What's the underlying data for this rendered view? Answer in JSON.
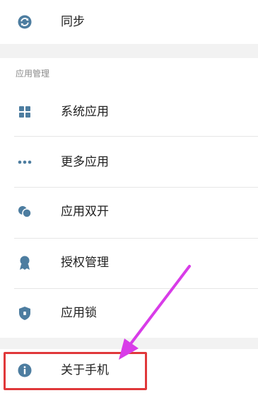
{
  "sync_item": {
    "label": "同步",
    "icon": "sync-icon"
  },
  "app_management": {
    "title": "应用管理",
    "items": [
      {
        "label": "系统应用",
        "icon": "grid-icon"
      },
      {
        "label": "更多应用",
        "icon": "more-dots-icon"
      },
      {
        "label": "应用双开",
        "icon": "dual-app-icon"
      },
      {
        "label": "授权管理",
        "icon": "badge-icon"
      },
      {
        "label": "应用锁",
        "icon": "shield-lock-icon"
      }
    ]
  },
  "about_item": {
    "label": "关于手机",
    "icon": "info-icon"
  },
  "colors": {
    "icon": "#4d7da0",
    "highlight_border": "#e0383a",
    "arrow": "#d83ce8",
    "section_band": "#f2f2f2"
  }
}
